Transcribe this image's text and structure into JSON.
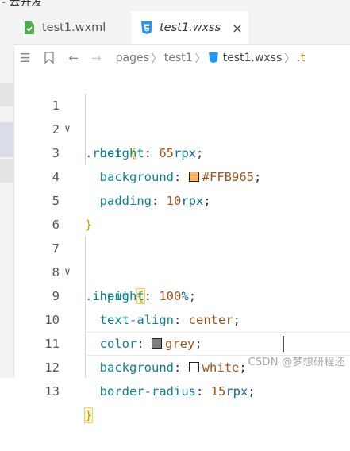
{
  "top_strip": {
    "text": "- 云开发"
  },
  "tabs": [
    {
      "label": "test1.wxml",
      "active": false,
      "icon": "wxml-file-icon"
    },
    {
      "label": "test1.wxss",
      "active": true,
      "icon": "css-file-icon",
      "close": "×"
    }
  ],
  "breadcrumb": {
    "items": [
      "pages",
      "test1",
      "test1.wxss",
      ".t"
    ]
  },
  "colors": {
    "swatch_root_bg": "#FFB965",
    "swatch_grey": "#808080",
    "swatch_white": "#ffffff",
    "brace": "#c9a200",
    "selector": "#0a7e86"
  },
  "code": {
    "lines": [
      {
        "n": "1",
        "selector": ".root",
        "brace": "{"
      },
      {
        "n": "2",
        "prop": "height",
        "num": "65",
        "unit": "rpx"
      },
      {
        "n": "3",
        "prop": "background",
        "value": "#FFB965"
      },
      {
        "n": "4",
        "prop": "padding",
        "num": "10",
        "unit": "rpx"
      },
      {
        "n": "5",
        "brace": "}"
      },
      {
        "n": "6"
      },
      {
        "n": "7",
        "selector": ".input",
        "brace": "{"
      },
      {
        "n": "8",
        "prop": "height",
        "num": "100",
        "unit": "%"
      },
      {
        "n": "9",
        "prop": "text-align",
        "value": "center"
      },
      {
        "n": "10",
        "prop": "color",
        "value": "grey"
      },
      {
        "n": "11",
        "prop": "background",
        "value": "white"
      },
      {
        "n": "12",
        "prop": "border-radius",
        "num": "15",
        "unit": "rpx"
      },
      {
        "n": "13",
        "brace": "}"
      }
    ]
  },
  "watermark": "CSDN @梦想研程还"
}
